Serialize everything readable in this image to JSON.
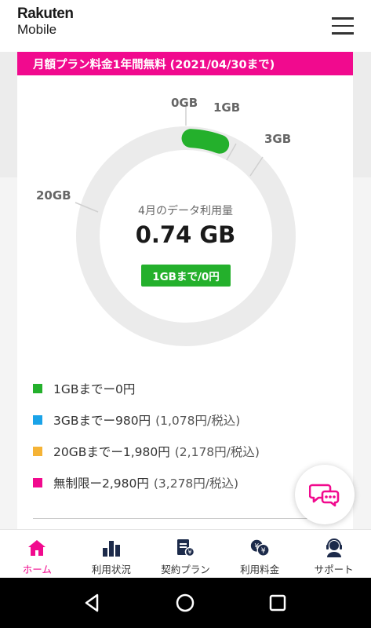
{
  "header": {
    "logo_top": "Rakuten",
    "logo_bottom": "Mobile",
    "menu_icon": "hamburger-menu-icon"
  },
  "banner": {
    "text": "月額プラン料金1年間無料 (2021/04/30まで)"
  },
  "usage": {
    "caption": "4月のデータ利用量",
    "value": "0.74 GB",
    "badge": "1GBまで/0円",
    "used_gb": 0.74
  },
  "ring_labels": [
    "0GB",
    "1GB",
    "3GB",
    "20GB"
  ],
  "legend": [
    {
      "color": "#24b02c",
      "text": "1GBまでー0円",
      "note": ""
    },
    {
      "color": "#1aa3e8",
      "text": "3GBまでー980円",
      "note": "(1,078円/税込)"
    },
    {
      "color": "#f5b335",
      "text": "20GBまでー1,980円",
      "note": "(2,178円/税込)"
    },
    {
      "color": "#f10a8e",
      "text": "無制限ー2,980円",
      "note": "(3,278円/税込)"
    }
  ],
  "chat": {
    "icon": "chat-bubbles-icon"
  },
  "bottom_nav": [
    {
      "label": "ホーム",
      "icon": "home-icon",
      "active": true
    },
    {
      "label": "利用状況",
      "icon": "bar-chart-icon",
      "active": false
    },
    {
      "label": "契約プラン",
      "icon": "contract-icon",
      "active": false
    },
    {
      "label": "利用料金",
      "icon": "yen-coins-icon",
      "active": false
    },
    {
      "label": "サポート",
      "icon": "headset-icon",
      "active": false
    }
  ],
  "colors": {
    "accent": "#f10a8e",
    "green": "#24b02c",
    "ring_track": "#ebebeb"
  }
}
